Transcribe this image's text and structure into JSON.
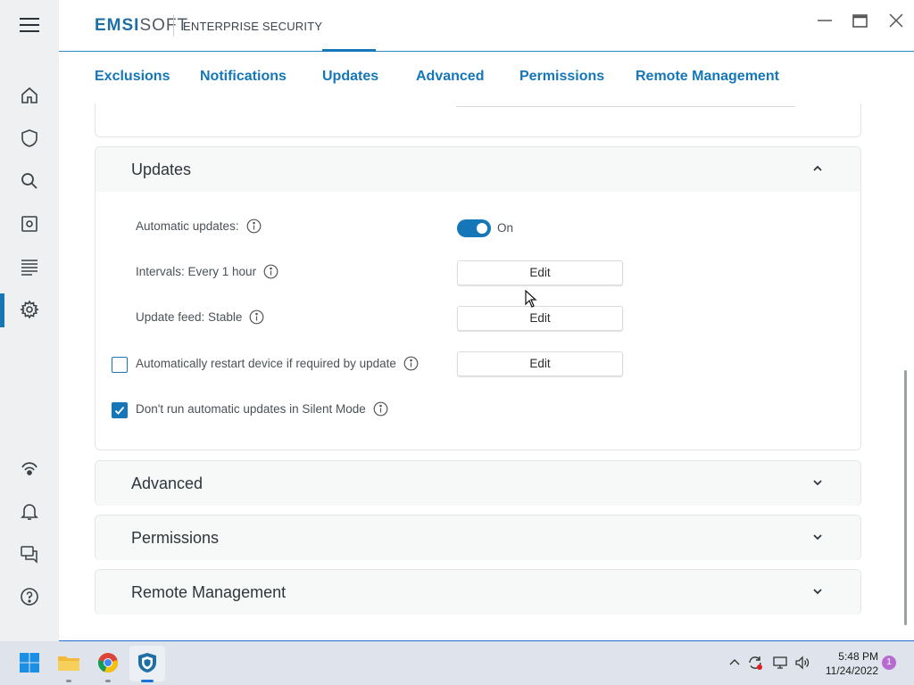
{
  "app": {
    "brand_a": "EMSI",
    "brand_b": "SOFT",
    "product": "ENTERPRISE SECURITY"
  },
  "tabs": [
    {
      "label": "Exclusions"
    },
    {
      "label": "Notifications"
    },
    {
      "label": "Updates"
    },
    {
      "label": "Advanced"
    },
    {
      "label": "Permissions"
    },
    {
      "label": "Remote Management"
    }
  ],
  "active_tab": "Updates",
  "updates_panel": {
    "title": "Updates",
    "expanded": true,
    "automatic_updates_label": "Automatic updates:",
    "automatic_updates_state": "On",
    "intervals_label": "Intervals: Every 1 hour",
    "intervals_button": "Edit",
    "feed_label": "Update feed: Stable",
    "feed_button": "Edit",
    "restart_label": "Automatically restart device if required by update",
    "restart_checked": false,
    "restart_button": "Edit",
    "silent_label": "Don't run automatic updates in Silent Mode",
    "silent_checked": true
  },
  "collapsed_panels": [
    {
      "title": "Advanced"
    },
    {
      "title": "Permissions"
    },
    {
      "title": "Remote Management"
    }
  ],
  "taskbar": {
    "time": "5:48 PM",
    "date": "11/24/2022",
    "notifications": "1"
  },
  "colors": {
    "accent": "#1577b7",
    "rail_bg": "#eef0f1",
    "taskbar_bg": "#dfe4ec"
  }
}
